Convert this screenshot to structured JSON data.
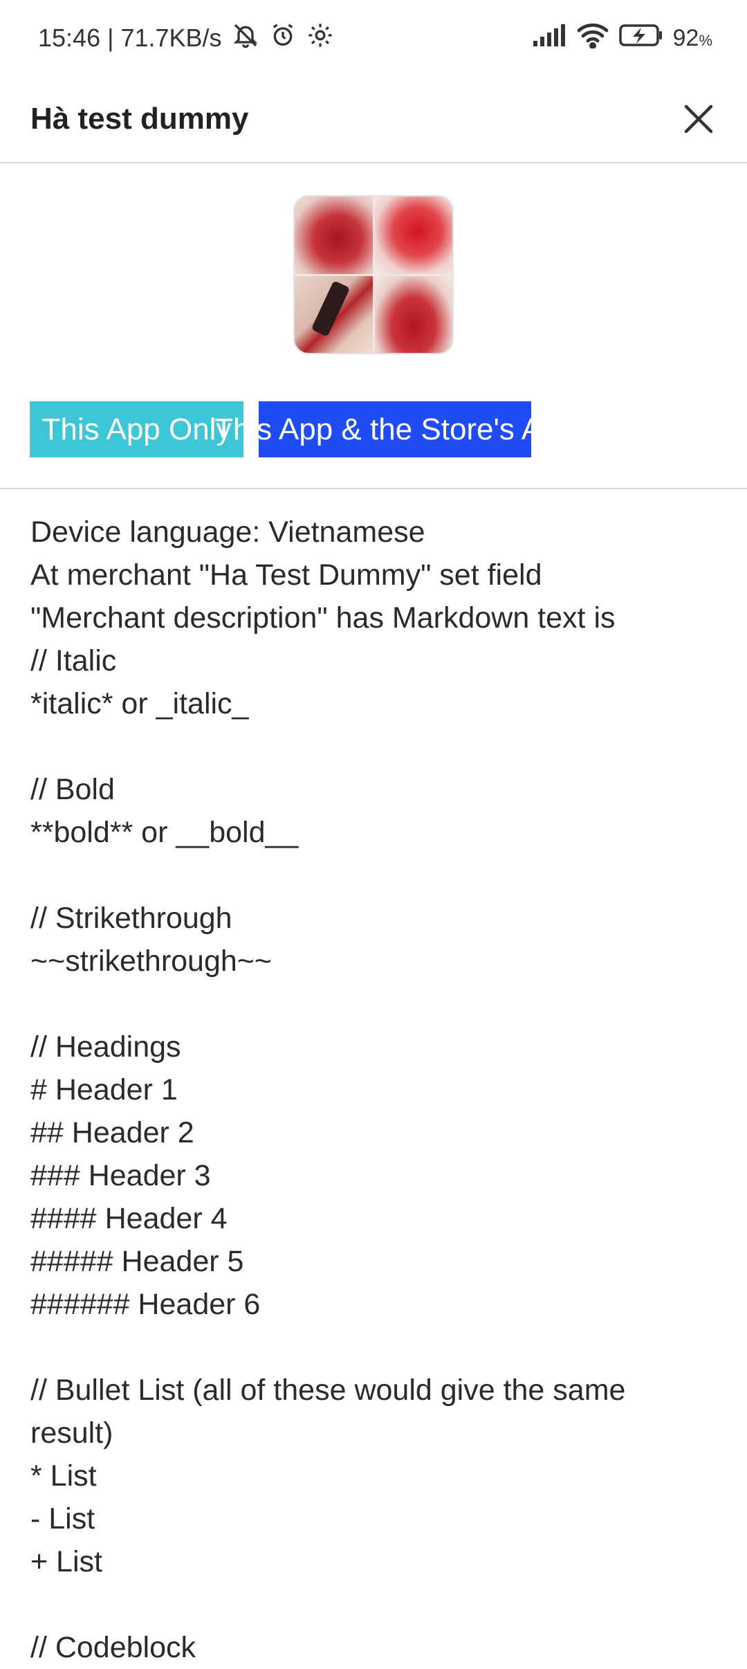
{
  "status_bar": {
    "time_speed": "15:46 | 71.7KB/s",
    "battery_percent": "92",
    "battery_unit": "%",
    "icons": [
      "mute-bell-icon",
      "alarm-icon",
      "settings-gear-icon",
      "signal-icon",
      "wifi-icon",
      "battery-charging-icon"
    ]
  },
  "header": {
    "title": "Hà test dummy",
    "close_icon": "close-icon"
  },
  "buttons": {
    "app_only_label": "This App Only",
    "app_store_label": "This App & the Store's App",
    "app_only_color": "#3cc6d6",
    "app_store_color": "#1f4cf5"
  },
  "description": "Device language: Vietnamese\nAt merchant \"Ha Test Dummy\" set field\n\"Merchant description\" has Markdown text is\n// Italic\n*italic* or _italic_\n\n// Bold\n**bold** or __bold__\n\n// Strikethrough\n~~strikethrough~~\n\n// Headings\n# Header 1\n## Header 2\n### Header 3\n#### Header 4\n##### Header 5\n###### Header 6\n\n// Bullet List (all of these would give the same\nresult)\n* List\n- List\n+ List\n\n// Codeblock"
}
